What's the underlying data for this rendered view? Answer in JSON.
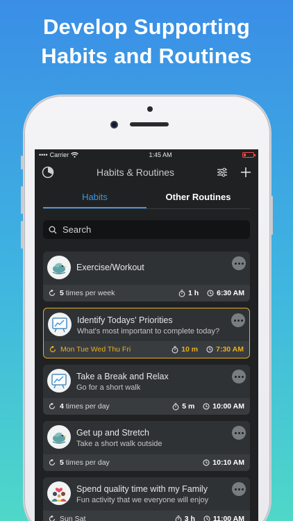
{
  "headline": {
    "line1": "Develop Supporting",
    "line2": "Habits and Routines"
  },
  "status": {
    "carrier": "Carrier",
    "time": "1:45 AM"
  },
  "nav": {
    "title": "Habits & Routines"
  },
  "tabs": [
    {
      "label": "Habits"
    },
    {
      "label": "Other Routines"
    }
  ],
  "search": {
    "placeholder": "Search"
  },
  "colors": {
    "accent": "#3d97e6",
    "highlight": "#e8b11c",
    "battery": "#ff4b4b"
  },
  "cards": [
    {
      "title": "Exercise/Workout",
      "subtitle": "",
      "freq_num": "5",
      "freq_text": "times per week",
      "duration": "1 h",
      "time": "6:30 AM",
      "icon": "bird-icon"
    },
    {
      "title": "Identify Todays' Priorities",
      "subtitle": "What's most important to complete today?",
      "freq_num": "",
      "freq_text": "Mon Tue Wed Thu Fri",
      "duration": "10 m",
      "time": "7:30 AM",
      "icon": "chart-board-icon"
    },
    {
      "title": "Take a Break and Relax",
      "subtitle": "Go for a short walk",
      "freq_num": "4",
      "freq_text": "times per day",
      "duration": "5 m",
      "time": "10:00 AM",
      "icon": "chart-board-icon"
    },
    {
      "title": "Get up and Stretch",
      "subtitle": "Take a short walk outside",
      "freq_num": "5",
      "freq_text": "times per day",
      "duration": "",
      "time": "10:10 AM",
      "icon": "bird-icon"
    },
    {
      "title": "Spend quality time with my Family",
      "subtitle": "Fun activity that we everyone will enjoy",
      "freq_num": "",
      "freq_text": "Sun Sat",
      "duration": "3 h",
      "time": "11:00 AM",
      "icon": "family-icon"
    }
  ]
}
